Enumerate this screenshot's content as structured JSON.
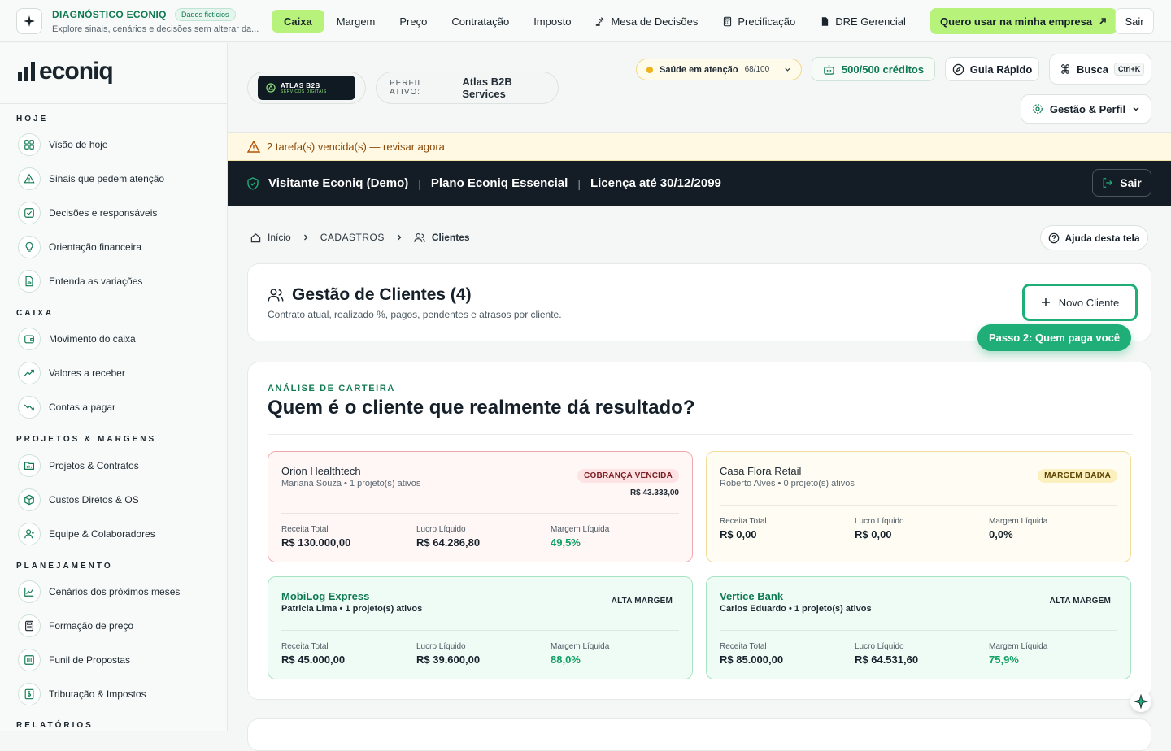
{
  "topbar": {
    "diag_title": "DIAGNÓSTICO ECONIQ",
    "diag_badge": "Dados fictícios",
    "diag_subtitle": "Explore sinais, cenários e decisões sem alterar da...",
    "nav": [
      {
        "label": "Caixa",
        "active": true,
        "icon": ""
      },
      {
        "label": "Margem",
        "active": false,
        "icon": ""
      },
      {
        "label": "Preço",
        "active": false,
        "icon": ""
      },
      {
        "label": "Contratação",
        "active": false,
        "icon": ""
      },
      {
        "label": "Imposto",
        "active": false,
        "icon": ""
      },
      {
        "label": "Mesa de Decisões",
        "active": false,
        "icon": "gavel-icon"
      },
      {
        "label": "Precificação",
        "active": false,
        "icon": "calculator-icon"
      },
      {
        "label": "DRE Gerencial",
        "active": false,
        "icon": "document-icon"
      }
    ],
    "cta_label": "Quero usar na minha empresa",
    "logout_label": "Sair"
  },
  "sidebar": {
    "logo_text": "econiq",
    "sections": [
      {
        "title": "HOJE",
        "items": [
          {
            "label": "Visão de hoje",
            "icon": "grid-icon"
          },
          {
            "label": "Sinais que pedem atenção",
            "icon": "warning-icon"
          },
          {
            "label": "Decisões e responsáveis",
            "icon": "checkbox-icon"
          },
          {
            "label": "Orientação financeira",
            "icon": "lightbulb-icon"
          },
          {
            "label": "Entenda as variações",
            "icon": "file-chart-icon"
          }
        ]
      },
      {
        "title": "CAIXA",
        "items": [
          {
            "label": "Movimento do caixa",
            "icon": "wallet-icon"
          },
          {
            "label": "Valores a receber",
            "icon": "trend-up-icon"
          },
          {
            "label": "Contas a pagar",
            "icon": "trend-down-icon"
          }
        ]
      },
      {
        "title": "PROJETOS & MARGENS",
        "items": [
          {
            "label": "Projetos & Contratos",
            "icon": "folder-icon"
          },
          {
            "label": "Custos Diretos & OS",
            "icon": "box-icon"
          },
          {
            "label": "Equipe & Colaboradores",
            "icon": "user-icon"
          }
        ]
      },
      {
        "title": "PLANEJAMENTO",
        "items": [
          {
            "label": "Cenários dos próximos meses",
            "icon": "line-chart-icon"
          },
          {
            "label": "Formação de preço",
            "icon": "calculator-icon"
          },
          {
            "label": "Funil de Propostas",
            "icon": "funnel-icon"
          },
          {
            "label": "Tributação & Impostos",
            "icon": "tax-icon"
          }
        ]
      },
      {
        "title": "RELATÓRIOS",
        "items": []
      }
    ]
  },
  "header": {
    "company_logo_line1": "ATLAS B2B",
    "company_logo_line2": "SERVIÇOS DIGITAIS",
    "perfil_key": "PERFIL ATIVO:",
    "perfil_value": "Atlas B2B Services",
    "saude_label": "Saúde em atenção",
    "saude_score": "68/100",
    "creditos": "500/500 créditos",
    "guia": "Guia Rápido",
    "busca": "Busca",
    "busca_kbd": "Ctrl+K",
    "gestao": "Gestão & Perfil"
  },
  "warning": "2 tarefa(s) vencida(s) — revisar agora",
  "demo_bar": {
    "user": "Visitante Econiq (Demo)",
    "plan": "Plano Econiq Essencial",
    "license": "Licença até 30/12/2099",
    "logout": "Sair"
  },
  "breadcrumb": {
    "home": "Início",
    "section": "CADASTROS",
    "current": "Clientes",
    "help": "Ajuda desta tela"
  },
  "gestao_card": {
    "title": "Gestão de Clientes (4)",
    "subtitle": "Contrato atual, realizado %, pagos, pendentes e atrasos por cliente.",
    "new_button": "Novo Cliente",
    "step_badge": "Passo 2: Quem paga você"
  },
  "analise": {
    "kicker": "ANÁLISE DE CARTEIRA",
    "title": "Quem é o cliente que realmente dá resultado?",
    "metric_labels": {
      "receita": "Receita Total",
      "lucro": "Lucro Líquido",
      "margem": "Margem Líquida"
    },
    "clients": [
      {
        "name": "Orion Healthtech",
        "detail": "Mariana Souza • 1 projeto(s) ativos",
        "tag": "COBRANÇA VENCIDA",
        "tag_amount": "R$ 43.333,00",
        "style": "red",
        "receita": "R$ 130.000,00",
        "lucro": "R$ 64.286,80",
        "margem": "49,5%"
      },
      {
        "name": "Casa Flora Retail",
        "detail": "Roberto Alves • 0 projeto(s) ativos",
        "tag": "MARGEM BAIXA",
        "tag_amount": "",
        "style": "yel",
        "receita": "R$ 0,00",
        "lucro": "R$ 0,00",
        "margem": "0,0%"
      },
      {
        "name": "MobiLog Express",
        "detail": "Patricia Lima • 1 projeto(s) ativos",
        "tag": "ALTA MARGEM",
        "tag_amount": "",
        "style": "grn",
        "receita": "R$ 45.000,00",
        "lucro": "R$ 39.600,00",
        "margem": "88,0%"
      },
      {
        "name": "Vertice Bank",
        "detail": "Carlos Eduardo • 1 projeto(s) ativos",
        "tag": "ALTA MARGEM",
        "tag_amount": "",
        "style": "grn",
        "receita": "R$ 85.000,00",
        "lucro": "R$ 64.531,60",
        "margem": "75,9%"
      }
    ]
  },
  "colors": {
    "accent": "#b7f27a",
    "brand_green": "#0f7a52",
    "dark_bar": "#141d26"
  }
}
